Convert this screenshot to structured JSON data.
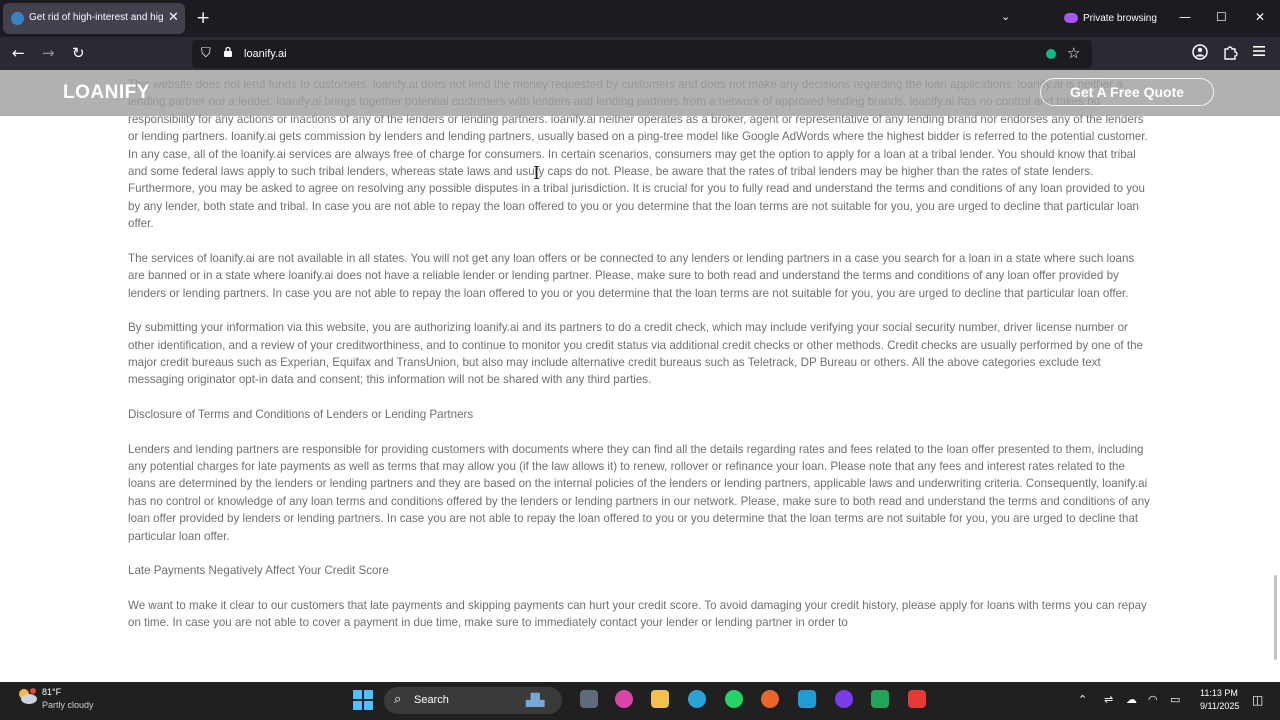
{
  "browser": {
    "tab_title": "Get rid of high-interest and hig",
    "tab_close": "✕",
    "new_tab": "+",
    "list_tabs": "⌄",
    "private_label": "Private browsing",
    "minimize": "—",
    "maximize": "☐",
    "close": "✕",
    "url": "loanify.ai",
    "back": "←",
    "forward": "→",
    "reload": "↻",
    "star": "☆"
  },
  "site": {
    "logo": "LOANIFY",
    "cta": "Get A Free Quote"
  },
  "content": {
    "p1": "This website does not lend funds to customers. loanify.ai does not lend the money requested by customers and does not make any decisions regarding the loan applications. loanify.ai is neither a lending partner nor a lender. loanify.ai brings together potential customers with lenders and lending partners from a network of approved lending brands. loanify.ai has no control and takes no responsibility for any actions or inactions of any of the lenders or lending partners. loanify.ai neither operates as a broker, agent or representative of any lending brand nor endorses any of the lenders or lending partners. loanify.ai gets commission by lenders and lending partners, usually based on a ping-tree model like Google AdWords where the highest bidder is referred to the potential customer. In any case, all of the loanify.ai services are always free of charge for consumers. In certain scenarios, consumers may get the option to apply for a loan at a tribal lender. You should know that tribal and some federal laws apply to such tribal lenders, whereas state laws and usury caps do not. Please, be aware that the rates of tribal lenders may be higher than the rates of state lenders. Furthermore, you may be asked to agree on resolving any possible disputes in a tribal jurisdiction. It is crucial for you to fully read and understand the terms and conditions of any loan provided to you by any lender, both state and tribal. In case you are not able to repay the loan offered to you or you determine that the loan terms are not suitable for you, you are urged to decline that particular loan offer.",
    "p2": "The services of loanify.ai are not available in all states. You will not get any loan offers or be connected to any lenders or lending partners in a case you search for a loan in a state where such loans are banned or in a state where loanify.ai does not have a reliable lender or lending partner. Please, make sure to both read and understand the terms and conditions of any loan offer provided by lenders or lending partners. In case you are not able to repay the loan offered to you or you determine that the loan terms are not suitable for you, you are urged to decline that particular loan offer.",
    "p3": "By submitting your information via this website, you are authorizing loanify.ai and its partners to do a credit check, which may include verifying your social security number, driver license number or other identification, and a review of your creditworthiness, and to continue to monitor you credit status via additional credit checks or other methods. Credit checks are usually performed by one of the major credit bureaus such as Experian, Equifax and TransUnion, but also may include alternative credit bureaus such as Teletrack, DP Bureau or others. All the above categories exclude text messaging originator opt-in data and consent; this information will not be shared with any third parties.",
    "h1": "Disclosure of Terms and Conditions of Lenders or Lending Partners",
    "p4": "Lenders and lending partners are responsible for providing customers with documents where they can find all the details regarding rates and fees related to the loan offer presented to them, including any potential charges for late payments as well as terms that may allow you (if the law allows it) to renew, rollover or refinance your loan. Please note that any fees and interest rates related to the loans are determined by the lenders or lending partners and they are based on the internal policies of the lenders or lending partners, applicable laws and underwriting criteria. Consequently, loanify.ai has no control or knowledge of any loan terms and conditions offered by the lenders or lending partners in our network. Please, make sure to both read and understand the terms and conditions of any loan offer provided by lenders or lending partners. In case you are not able to repay the loan offered to you or you determine that the loan terms are not suitable for you, you are urged to decline that particular loan offer.",
    "h2": "Late Payments Negatively Affect Your Credit Score",
    "p5": "We want to make it clear to our customers that late payments and skipping payments can hurt your credit score. To avoid damaging your credit history, please apply for loans with terms you can repay on time. In case you are not able to cover a payment in due time, make sure to immediately contact your lender or lending partner in order to"
  },
  "taskbar": {
    "weather_temp": "81°F",
    "weather_desc": "Partly cloudy",
    "search_label": "Search",
    "time": "11:13 PM",
    "date": "9/11/2025"
  },
  "colors": {
    "tab_bar": "#1c1b22",
    "nav_bar": "#2b2a33",
    "body_text": "#707070",
    "header_overlay": "#a0a0a0",
    "taskbar": "#202020",
    "windows_accent": "#4cc2ff"
  }
}
